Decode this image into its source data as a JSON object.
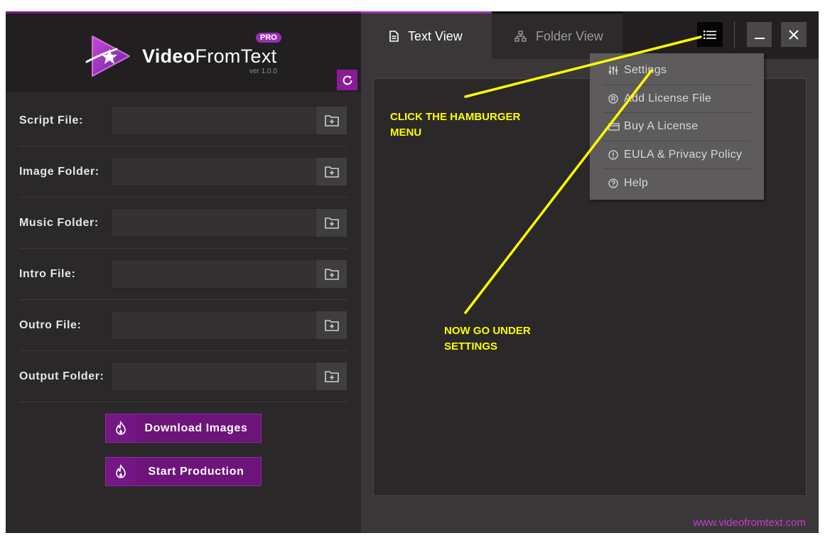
{
  "app": {
    "brand_bold": "Video",
    "brand_light": "FromText",
    "badge": "PRO",
    "version": "ver 1.0.0"
  },
  "form": {
    "rows": [
      {
        "label": "Script File:",
        "value": ""
      },
      {
        "label": "Image Folder:",
        "value": ""
      },
      {
        "label": "Music Folder:",
        "value": ""
      },
      {
        "label": "Intro File:",
        "value": ""
      },
      {
        "label": "Outro File:",
        "value": ""
      },
      {
        "label": "Output Folder:",
        "value": ""
      }
    ]
  },
  "actions": {
    "download_label": "Download Images",
    "production_label": "Start Production"
  },
  "tabs": [
    {
      "label": "Text View",
      "active": true,
      "icon": "document-icon"
    },
    {
      "label": "Folder View",
      "active": false,
      "icon": "sitemap-icon"
    }
  ],
  "menu": {
    "items": [
      {
        "label": "Settings",
        "icon": "sliders-icon"
      },
      {
        "label": "Add License File",
        "icon": "registered-icon"
      },
      {
        "label": "Buy A License",
        "icon": "cart-icon"
      },
      {
        "label": "EULA & Privacy Policy",
        "icon": "info-icon"
      },
      {
        "label": "Help",
        "icon": "help-icon"
      }
    ]
  },
  "text_view": {
    "content": ""
  },
  "footer": {
    "website": "www.videofromtext.com"
  },
  "annotations": {
    "first": "CLICK THE HAMBURGER MENU",
    "second": "NOW GO UNDER SETTINGS"
  },
  "colors": {
    "accent": "#8a1a97",
    "annotation": "#ffff00",
    "link": "#c93ad6",
    "panel": "#2b2829"
  }
}
